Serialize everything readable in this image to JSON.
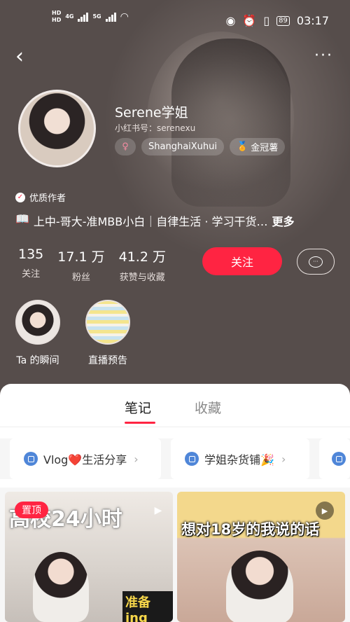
{
  "status": {
    "hd1": "HD",
    "hd2": "HD",
    "net1": "4G",
    "net2": "5G",
    "battery": "89",
    "time": "03:17"
  },
  "nav": {
    "back_glyph": "‹",
    "more_glyph": "···"
  },
  "profile": {
    "name": "Serene学姐",
    "id_label": "小红书号：serenexu",
    "gender_glyph": "♀",
    "location": "ShanghaiXuhui",
    "badge": "金冠薯",
    "quality_label": "优质作者",
    "bio_icon": "📖",
    "bio": "上中-哥大-准MBB小白｜自律生活 · 学习干货…",
    "bio_more": "更多"
  },
  "stats": [
    {
      "num": "135",
      "label": "关注"
    },
    {
      "num": "17.1 万",
      "label": "粉丝"
    },
    {
      "num": "41.2 万",
      "label": "获赞与收藏"
    }
  ],
  "actions": {
    "follow": "关注",
    "message_glyph": "···"
  },
  "highlights": [
    {
      "label": "Ta 的瞬间"
    },
    {
      "label": "直播预告"
    }
  ],
  "tabs": [
    {
      "label": "笔记",
      "active": true
    },
    {
      "label": "收藏",
      "active": false
    }
  ],
  "collections": [
    {
      "label": "Vlog❤️生活分享"
    },
    {
      "label": "学姐杂货铺🎉"
    }
  ],
  "notes": [
    {
      "pinned": "置顶",
      "title": "高校24小时",
      "sub": "准备ing",
      "play": "▶"
    },
    {
      "title": "想对18岁的我说的话",
      "play": "▶"
    }
  ],
  "colors": {
    "accent": "#ff2442",
    "chip_icon": "#4f86d8"
  }
}
